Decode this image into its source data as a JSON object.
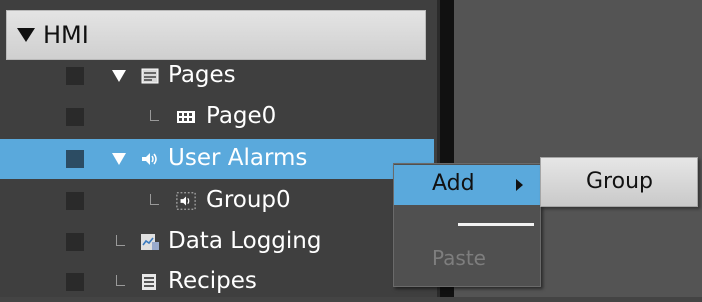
{
  "tree": {
    "root_label": "HMI",
    "items": [
      {
        "label": "Pages",
        "icon": "pages-icon"
      },
      {
        "label": "Page0",
        "icon": "page-grid-icon"
      },
      {
        "label": "User Alarms",
        "icon": "speaker-icon"
      },
      {
        "label": "Group0",
        "icon": "alarm-group-icon"
      },
      {
        "label": "Data Logging",
        "icon": "data-logging-icon"
      },
      {
        "label": "Recipes",
        "icon": "recipes-icon"
      }
    ]
  },
  "context_menu": {
    "add_label": "Add",
    "paste_label": "Paste"
  },
  "submenu": {
    "group_label": "Group"
  },
  "colors": {
    "selection": "#5aa9dc",
    "panel_bg": "#3f3f3f"
  }
}
